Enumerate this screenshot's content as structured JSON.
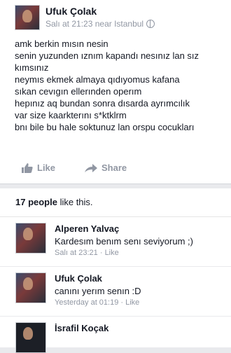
{
  "post": {
    "author": "Ufuk Çolak",
    "meta": "Salı at 21:23 near Istanbul",
    "lines": [
      "amk berkin mısın nesin",
      "senin yuzunden ıznım kapandı nesınız lan sız",
      "kımsınız",
      "neymıs ekmek almaya qıdıyomus kafana",
      "sıkan cevıgın ellerınden operım",
      "hepınız aq bundan sonra dısarda ayrımcılık",
      "var size kaarkterını s*ktklrm",
      "bnı bile bu hale soktunuz lan orspu cocukları"
    ],
    "like_label": "Like",
    "share_label": "Share"
  },
  "likes": {
    "count": "17 people",
    "suffix": " like this."
  },
  "comments": [
    {
      "name": "Alperen Yalvaç",
      "text": "Kardesım benım senı seviyorum ;)",
      "time": "Salı at 23:21",
      "sep": " · ",
      "like": "Like"
    },
    {
      "name": "Ufuk Çolak",
      "text": "canını yerım senın :D",
      "time": "Yesterday at 01:19",
      "sep": " · ",
      "like": "Like"
    },
    {
      "name": "İsrafil Koçak"
    }
  ],
  "icons": [
    "thumbs-up-icon",
    "share-arrow-icon",
    "globe-icon"
  ],
  "colors": {
    "secondary_text": "#9197a3",
    "text": "#141823",
    "background": "#e9eaed"
  }
}
